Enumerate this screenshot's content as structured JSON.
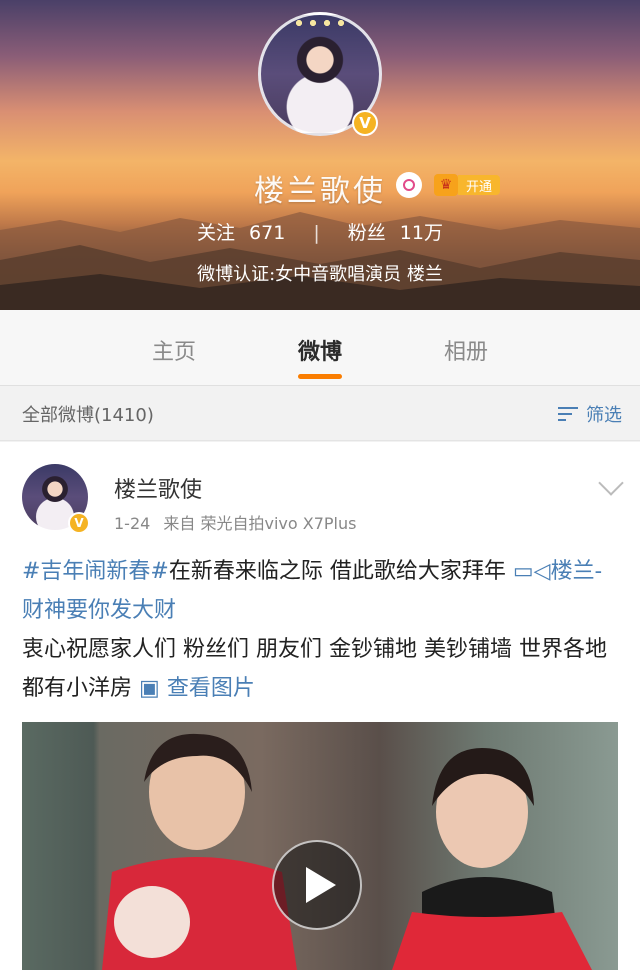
{
  "profile": {
    "name": "楼兰歌使",
    "vip_label": "开通",
    "follow_label": "关注",
    "follow_count": "671",
    "fans_label": "粉丝",
    "fans_count": "11万",
    "certification": "微博认证:女中音歌唱演员 楼兰"
  },
  "tabs": [
    {
      "label": "主页",
      "active": false
    },
    {
      "label": "微博",
      "active": true
    },
    {
      "label": "相册",
      "active": false
    }
  ],
  "filter": {
    "all_label": "全部微博(1410)",
    "filter_label": "筛选"
  },
  "post": {
    "author": "楼兰歌使",
    "time": "1-24",
    "source": "来自 荣光自拍vivo X7Plus",
    "hashtag": "#吉年闹新春#",
    "text1": "在新春来临之际 借此歌给大家拜年",
    "video_link": "楼兰-财神要你发大财",
    "text2": "衷心祝愿家人们 粉丝们 朋友们 金钞铺地 美钞铺墙 世界各地都有小洋房",
    "view_pics": "查看图片"
  },
  "colors": {
    "accent": "#fa7d00",
    "link": "#4a7fb5",
    "verified": "#f5b323"
  }
}
